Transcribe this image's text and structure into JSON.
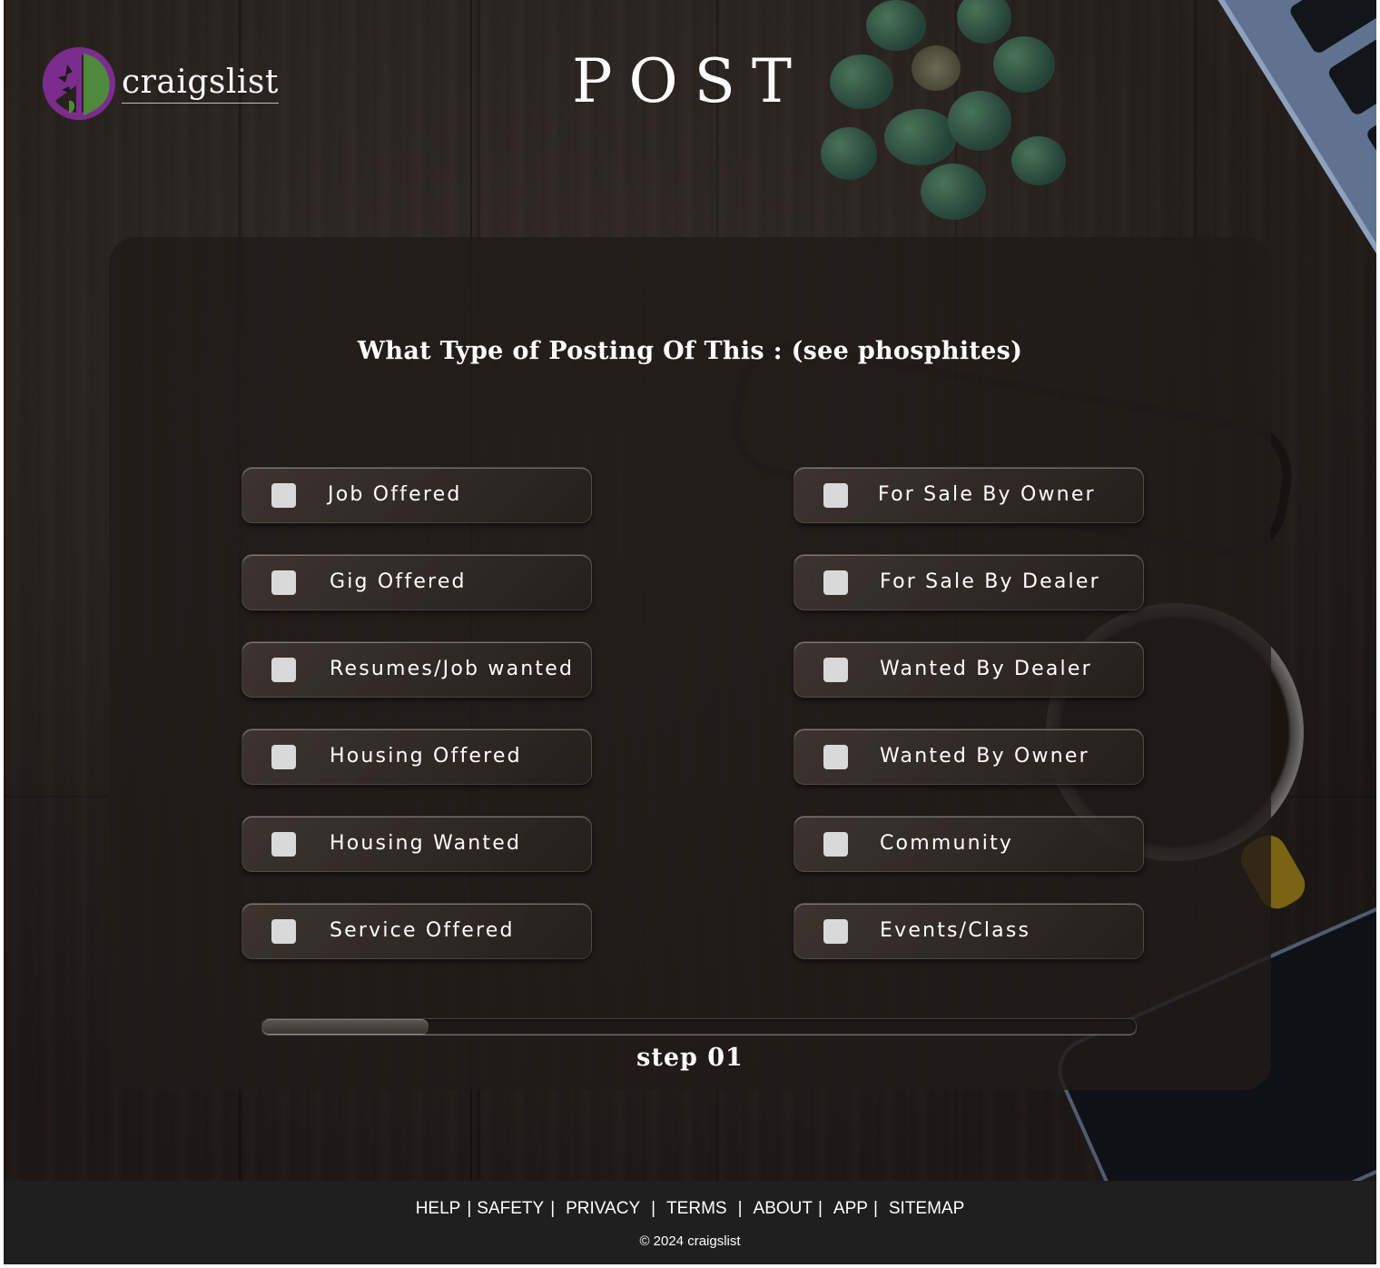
{
  "header": {
    "logo_text": "craigslist",
    "page_title": "POST"
  },
  "form": {
    "question": "What Type of Posting Of This : (see phosphites)",
    "left_options": [
      {
        "label": "Job Offered",
        "checked": false
      },
      {
        "label": "Gig Offered",
        "checked": false
      },
      {
        "label": "Resumes/Job wanted",
        "checked": false
      },
      {
        "label": "Housing Offered",
        "checked": false
      },
      {
        "label": "Housing Wanted",
        "checked": false
      },
      {
        "label": "Service Offered",
        "checked": false
      }
    ],
    "right_options": [
      {
        "label": "For Sale By Owner",
        "checked": false
      },
      {
        "label": "For Sale By Dealer",
        "checked": false
      },
      {
        "label": "Wanted By Dealer",
        "checked": false
      },
      {
        "label": "Wanted By Owner",
        "checked": false
      },
      {
        "label": "Community",
        "checked": false
      },
      {
        "label": "Events/Class",
        "checked": false
      }
    ],
    "progress_fraction": 0.19,
    "step_label": "step 01"
  },
  "footer": {
    "links": [
      "HELP",
      "SAFETY",
      "PRIVACY",
      "TERMS",
      "ABOUT",
      "APP",
      "SITEMAP"
    ],
    "separator": "|",
    "copyright": "© 2024 craigslist"
  },
  "colors": {
    "logo_purple": "#7b2d8e",
    "logo_green": "#4f8a3c",
    "checkbox_fill": "#d9d9d9",
    "footer_bg": "#1f1f1f"
  }
}
